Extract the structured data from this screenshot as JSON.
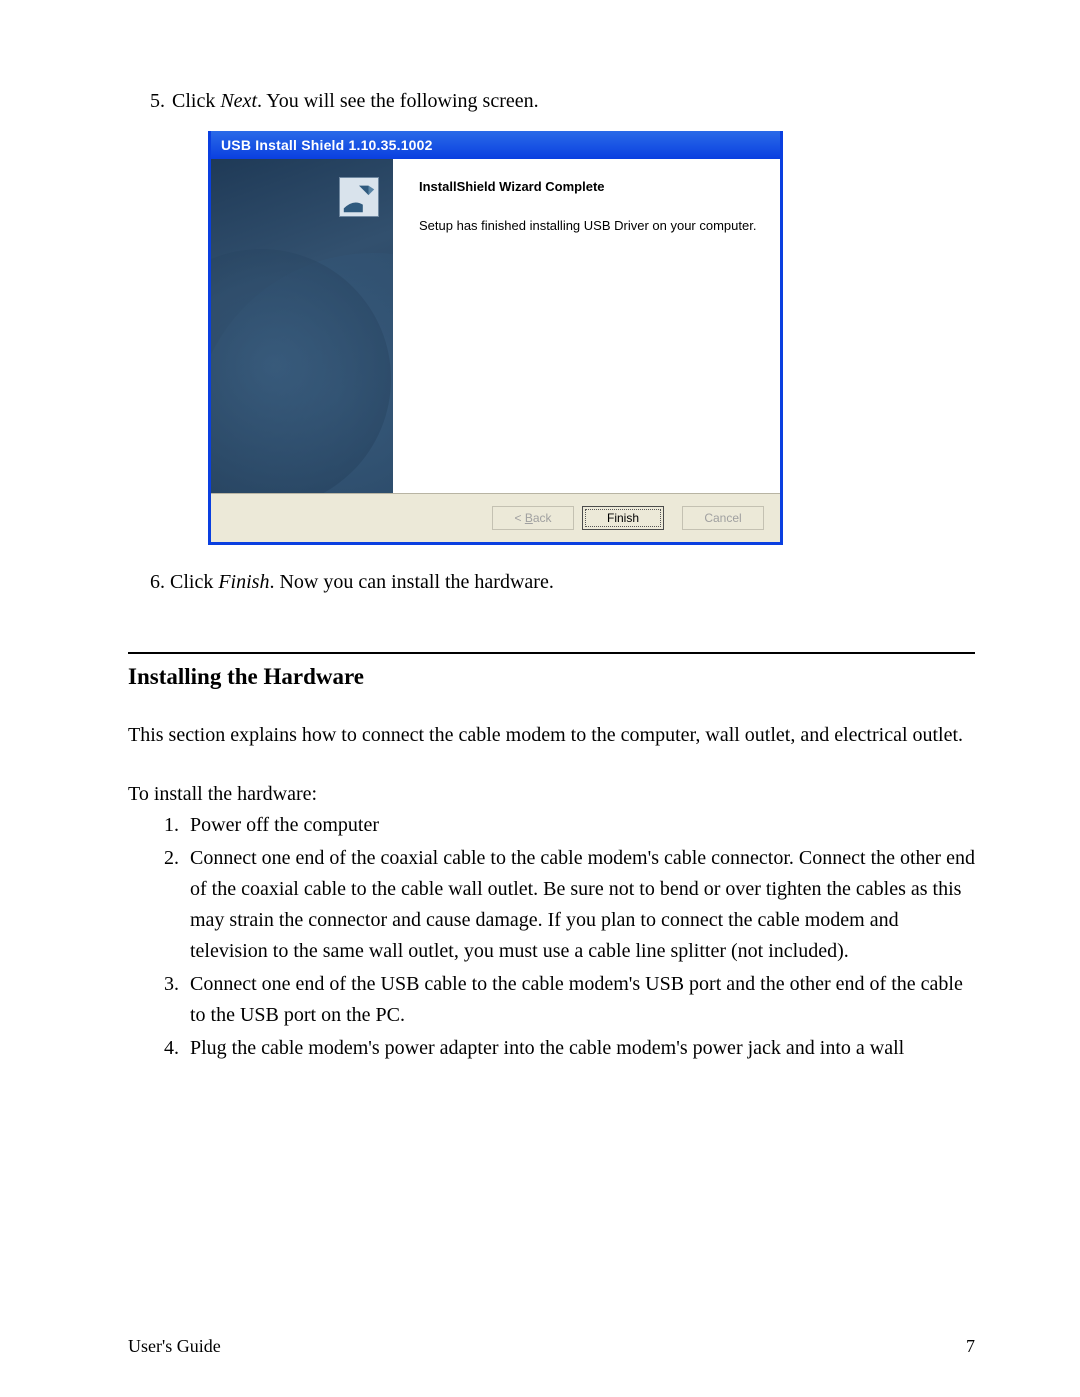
{
  "step5": {
    "num": "5.",
    "pre": "Click ",
    "italic": "Next",
    "post": ". You will see the following screen."
  },
  "dialog": {
    "title": "USB Install Shield 1.10.35.1002",
    "heading": "InstallShield Wizard Complete",
    "message": "Setup has finished installing USB Driver on your computer.",
    "buttons": {
      "back_prefix": "< ",
      "back_underline": "B",
      "back_suffix": "ack",
      "finish": "Finish",
      "cancel": "Cancel"
    }
  },
  "step6": {
    "num": "6.",
    "pre": "Click ",
    "italic": "Finish",
    "post": ". Now you can install the hardware."
  },
  "section": {
    "title": "Installing the Hardware",
    "intro": "This section explains how to connect the cable modem to the computer, wall outlet, and electrical outlet.",
    "lead": "To install the hardware:",
    "steps": [
      "Power off the computer",
      "Connect one end of the coaxial cable to the cable modem's cable connector.  Connect the other end of the coaxial cable to the cable wall outlet.  Be sure not to bend or over tighten the cables as this may strain the connector and cause damage.  If you plan to connect the cable modem and television to the same wall outlet, you must use a cable line splitter (not included).",
      "Connect one end of the USB cable to the cable modem's USB port and the other end of the cable to the USB port on the PC.",
      "Plug the cable modem's power adapter into the cable modem's power jack and into a wall"
    ]
  },
  "footer": {
    "left": "User's Guide",
    "right": "7"
  }
}
